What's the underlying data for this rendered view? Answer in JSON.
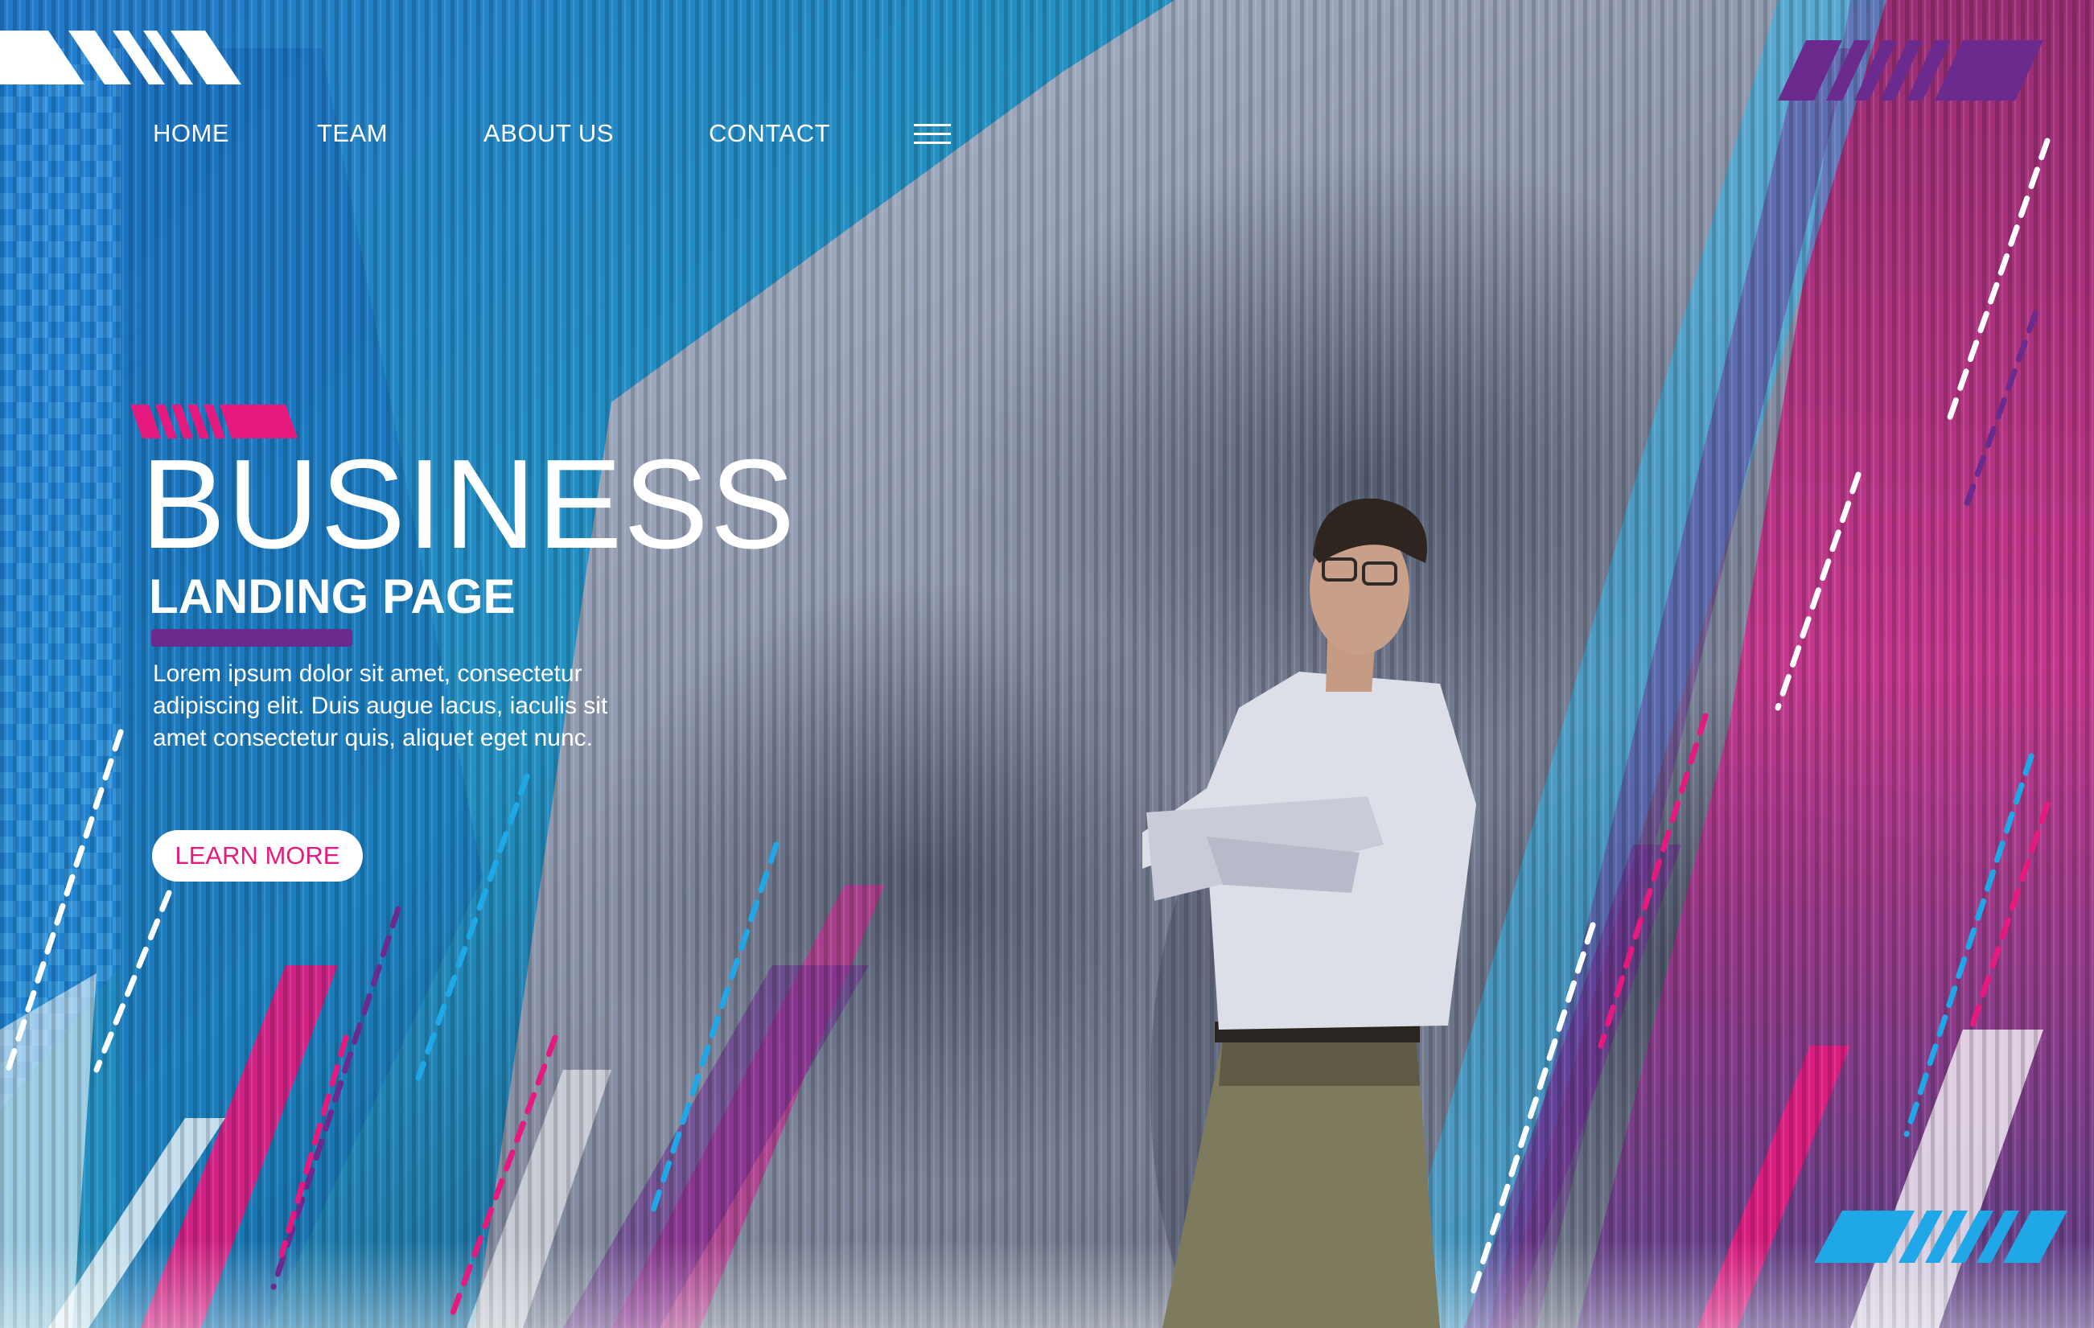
{
  "nav": {
    "items": [
      {
        "label": "HOME"
      },
      {
        "label": "TEAM"
      },
      {
        "label": "ABOUT US"
      },
      {
        "label": "CONTACT"
      }
    ],
    "menu_icon": "hamburger-menu-icon"
  },
  "hero": {
    "title": "BUSINESS",
    "subtitle": "LANDING PAGE",
    "body": "Lorem ipsum dolor sit amet, consectetur adipiscing elit. Duis augue lacus, iaculis sit amet consectetur quis, aliquet eget nunc.",
    "cta_label": "LEARN MORE"
  },
  "colors": {
    "accent_pink": "#e6197f",
    "accent_blue": "#1fa7e8",
    "accent_purple": "#6a2a8e",
    "deep_blue": "#0b4f9e",
    "wall_gray": "#8e95a8"
  }
}
